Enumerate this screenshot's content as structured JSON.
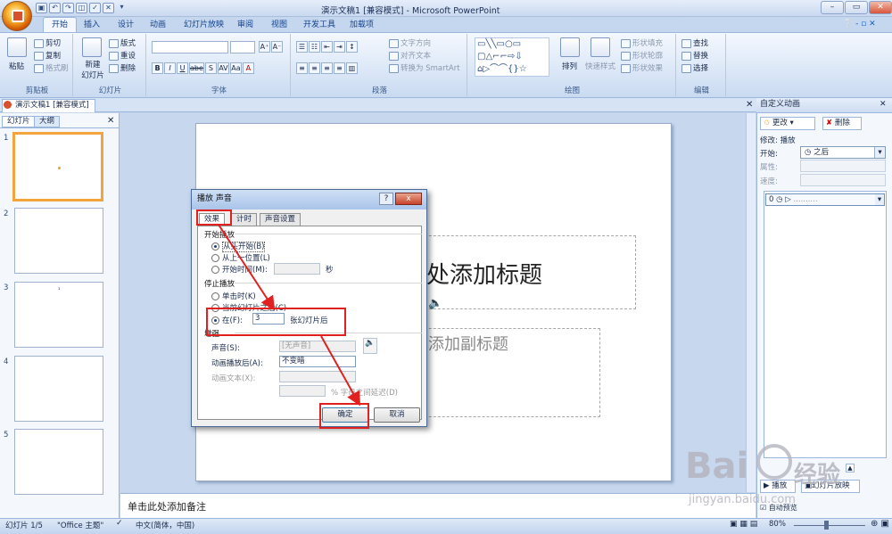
{
  "window": {
    "title": "演示文稿1 [兼容模式] - Microsoft PowerPoint"
  },
  "quick_access": [
    "save",
    "undo",
    "redo",
    "print-preview",
    "spelling",
    "close",
    "more"
  ],
  "tabs": [
    "开始",
    "插入",
    "设计",
    "动画",
    "幻灯片放映",
    "审阅",
    "视图",
    "开发工具",
    "加载项"
  ],
  "active_tab": "开始",
  "ribbon": {
    "clipboard": {
      "label": "剪贴板",
      "paste": "粘贴",
      "cut": "剪切",
      "copy": "复制",
      "format_painter": "格式刷"
    },
    "slides": {
      "label": "幻灯片",
      "new_slide": "新建\n幻灯片",
      "layout": "版式",
      "reset": "重设",
      "delete": "删除"
    },
    "font": {
      "label": "字体",
      "buttons": [
        "B",
        "I",
        "U",
        "abe",
        "S",
        "AV",
        "Aa",
        "A"
      ]
    },
    "paragraph": {
      "label": "段落",
      "text_direction": "文字方向",
      "align_text": "对齐文本",
      "smartart": "转换为 SmartArt"
    },
    "drawing": {
      "label": "绘图",
      "arrange": "排列",
      "quick_styles": "快速样式",
      "shape_fill": "形状填充",
      "shape_outline": "形状轮廓",
      "shape_effects": "形状效果"
    },
    "editing": {
      "label": "编辑",
      "find": "查找",
      "replace": "替换",
      "select": "选择"
    }
  },
  "doc_tab": "演示文稿1 [兼容模式]",
  "left_pane": {
    "tabs": [
      "幻灯片",
      "大纲"
    ],
    "slides": [
      "1",
      "2",
      "3",
      "4",
      "5"
    ]
  },
  "slide": {
    "title_placeholder": "处添加标题",
    "subtitle_placeholder": "添加副标题"
  },
  "notes_placeholder": "单击此处添加备注",
  "custom_animation": {
    "title": "自定义动画",
    "change_button": "更改",
    "delete_button": "删除",
    "modify_label": "修改: 播放",
    "start_label": "开始:",
    "start_value": "之后",
    "property_label": "属性:",
    "speed_label": "速度:",
    "list_item_index": "0",
    "play_button": "播放",
    "slideshow_button": "幻灯片放映",
    "autopreview": "自动预览"
  },
  "dialog": {
    "title": "播放 声音",
    "help": "?",
    "close": "x",
    "tabs": [
      "效果",
      "计时",
      "声音设置"
    ],
    "start_section": "开始播放",
    "start_options": [
      "从头开始(B)",
      "从上一位置(L)",
      "开始时间(M):"
    ],
    "start_unit": "秒",
    "stop_section": "停止播放",
    "stop_options": [
      "单击时(K)",
      "当前幻灯片之后(C)",
      "在(F):"
    ],
    "stop_after_value": "3",
    "stop_after_unit": "张幻灯片后",
    "enhance_section": "增强",
    "sound_label": "声音(S):",
    "sound_value": "[无声音]",
    "after_anim_label": "动画播放后(A):",
    "after_anim_value": "不变暗",
    "anim_text_label": "动画文本(X):",
    "delay_text": "% 字母之间延迟(D)",
    "ok": "确定",
    "cancel": "取消"
  },
  "status": {
    "slide": "幻灯片 1/5",
    "theme": "\"Office 主题\"",
    "language": "中文(简体，中国)",
    "zoom": "80%"
  },
  "watermark": {
    "brand": "Bai",
    "brand2": "经验",
    "url": "jingyan.baidu.com"
  },
  "colors": {
    "highlight_red": "#e0211f",
    "accent_orange": "#f3a43b",
    "ribbon_blue": "#c5d7ef"
  }
}
